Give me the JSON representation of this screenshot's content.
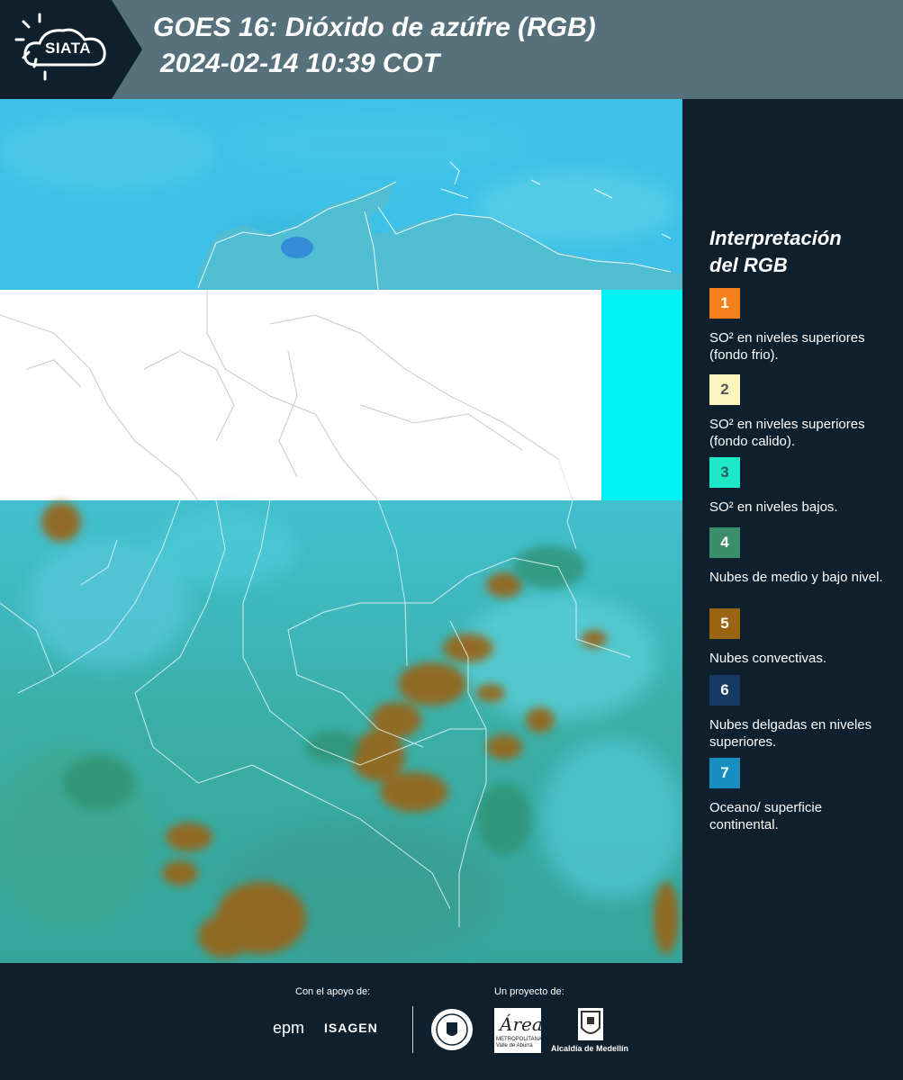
{
  "header": {
    "logo_text": "SIATA",
    "title_line1": "GOES 16: Dióxido de azúfre (RGB)",
    "title_line2": "2024-02-14 10:39 COT"
  },
  "legend": {
    "title_line1": "Interpretación",
    "title_line2": "del RGB",
    "items": [
      {
        "number": "1",
        "color": "#f47f1b",
        "number_color": "#ffffff",
        "text": "SO² en niveles superiores (fondo frio)."
      },
      {
        "number": "2",
        "color": "#fdf5c0",
        "number_color": "#555555",
        "text": "SO² en niveles superiores (fondo calido)."
      },
      {
        "number": "3",
        "color": "#1de8c8",
        "number_color": "#2b5a55",
        "text": "SO² en niveles bajos."
      },
      {
        "number": "4",
        "color": "#3a8f6a",
        "number_color": "#ffffff",
        "text": "Nubes de medio y bajo nivel."
      },
      {
        "number": "5",
        "color": "#9a6412",
        "number_color": "#ffffff",
        "text": "Nubes convectivas."
      },
      {
        "number": "6",
        "color": "#173a64",
        "number_color": "#ffffff",
        "text": "Nubes delgadas en niveles superiores."
      },
      {
        "number": "7",
        "color": "#168fc0",
        "number_color": "#ffffff",
        "text": "Oceano/ superficie continental."
      }
    ]
  },
  "footer": {
    "support_label": "Con el apoyo de:",
    "project_label": "Un proyecto de:",
    "sponsor_1": "epm",
    "sponsor_2": "ISAGEN",
    "project_1_main": "Área",
    "project_1_sub": "METROPOLITANA Valle de Aburrá",
    "project_2": "Alcaldía de Medellín"
  },
  "colors": {
    "header_bg": "#56707c",
    "page_bg": "#0e1f2d",
    "ocean": "#3fc3e6",
    "land_cloud": "#38a7a0",
    "convective": "#9a6412"
  }
}
